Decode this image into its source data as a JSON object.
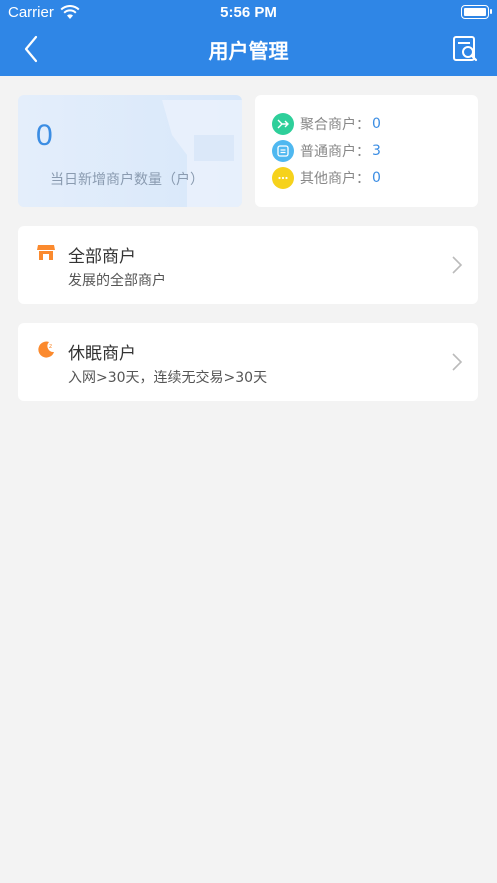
{
  "status_bar": {
    "carrier": "Carrier",
    "time": "5:56 PM"
  },
  "nav": {
    "title": "用户管理",
    "back_icon": "chevron-left-icon",
    "action_icon": "document-search-icon"
  },
  "stats": {
    "value": "0",
    "label": "当日新增商户数量（户）"
  },
  "merchant_types": [
    {
      "label": "聚合商户：",
      "value": "0",
      "icon": "merge-icon",
      "color": "#2ecf9a"
    },
    {
      "label": "普通商户：",
      "value": "3",
      "icon": "card-icon",
      "color": "#4fb8f0"
    },
    {
      "label": "其他商户：",
      "value": "0",
      "icon": "more-icon",
      "color": "#f6d21c"
    }
  ],
  "list": [
    {
      "title": "全部商户",
      "subtitle": "发展的全部商户",
      "icon": "shop-icon",
      "color": "#fb8a2e"
    },
    {
      "title": "休眠商户",
      "subtitle": "入网>30天，连续无交易>30天",
      "icon": "moon-icon",
      "color": "#fb8a2e"
    }
  ]
}
